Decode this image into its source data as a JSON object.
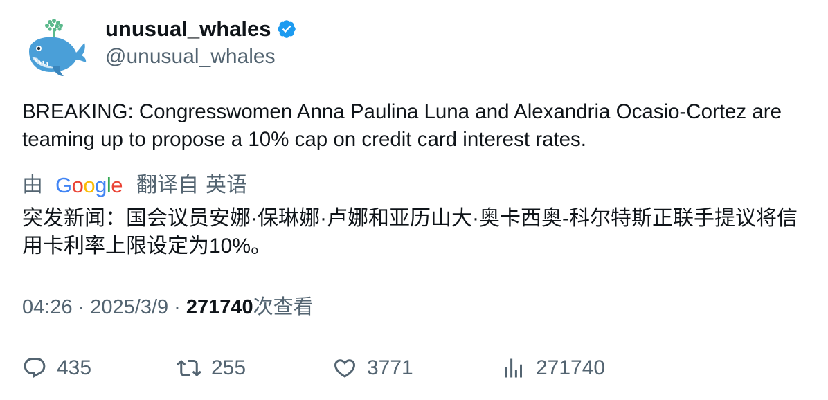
{
  "author": {
    "display_name": "unusual_whales",
    "handle": "@unusual_whales",
    "verified": true
  },
  "tweet": {
    "text": "BREAKING: Congresswomen Anna Paulina Luna and Alexandria Ocasio-Cortez are teaming up to propose a 10% cap on credit card interest rates.",
    "translation_prefix": "由",
    "translation_provider": "Google",
    "translation_from_label": "翻译自",
    "translation_source_language": "英语",
    "translated_text": "突发新闻：国会议员安娜·保琳娜·卢娜和亚历山大·奥卡西奥-科尔特斯正联手提议将信用卡利率上限设定为10%。"
  },
  "meta": {
    "time": "04:26",
    "separator": "·",
    "date": "2025/3/9",
    "views_count": "271740",
    "views_label": "次查看"
  },
  "actions": {
    "replies": "435",
    "retweets": "255",
    "likes": "3771",
    "views": "271740"
  },
  "colors": {
    "text_primary": "#0f1419",
    "text_secondary": "#536471",
    "verified_badge": "#1d9bf0"
  }
}
